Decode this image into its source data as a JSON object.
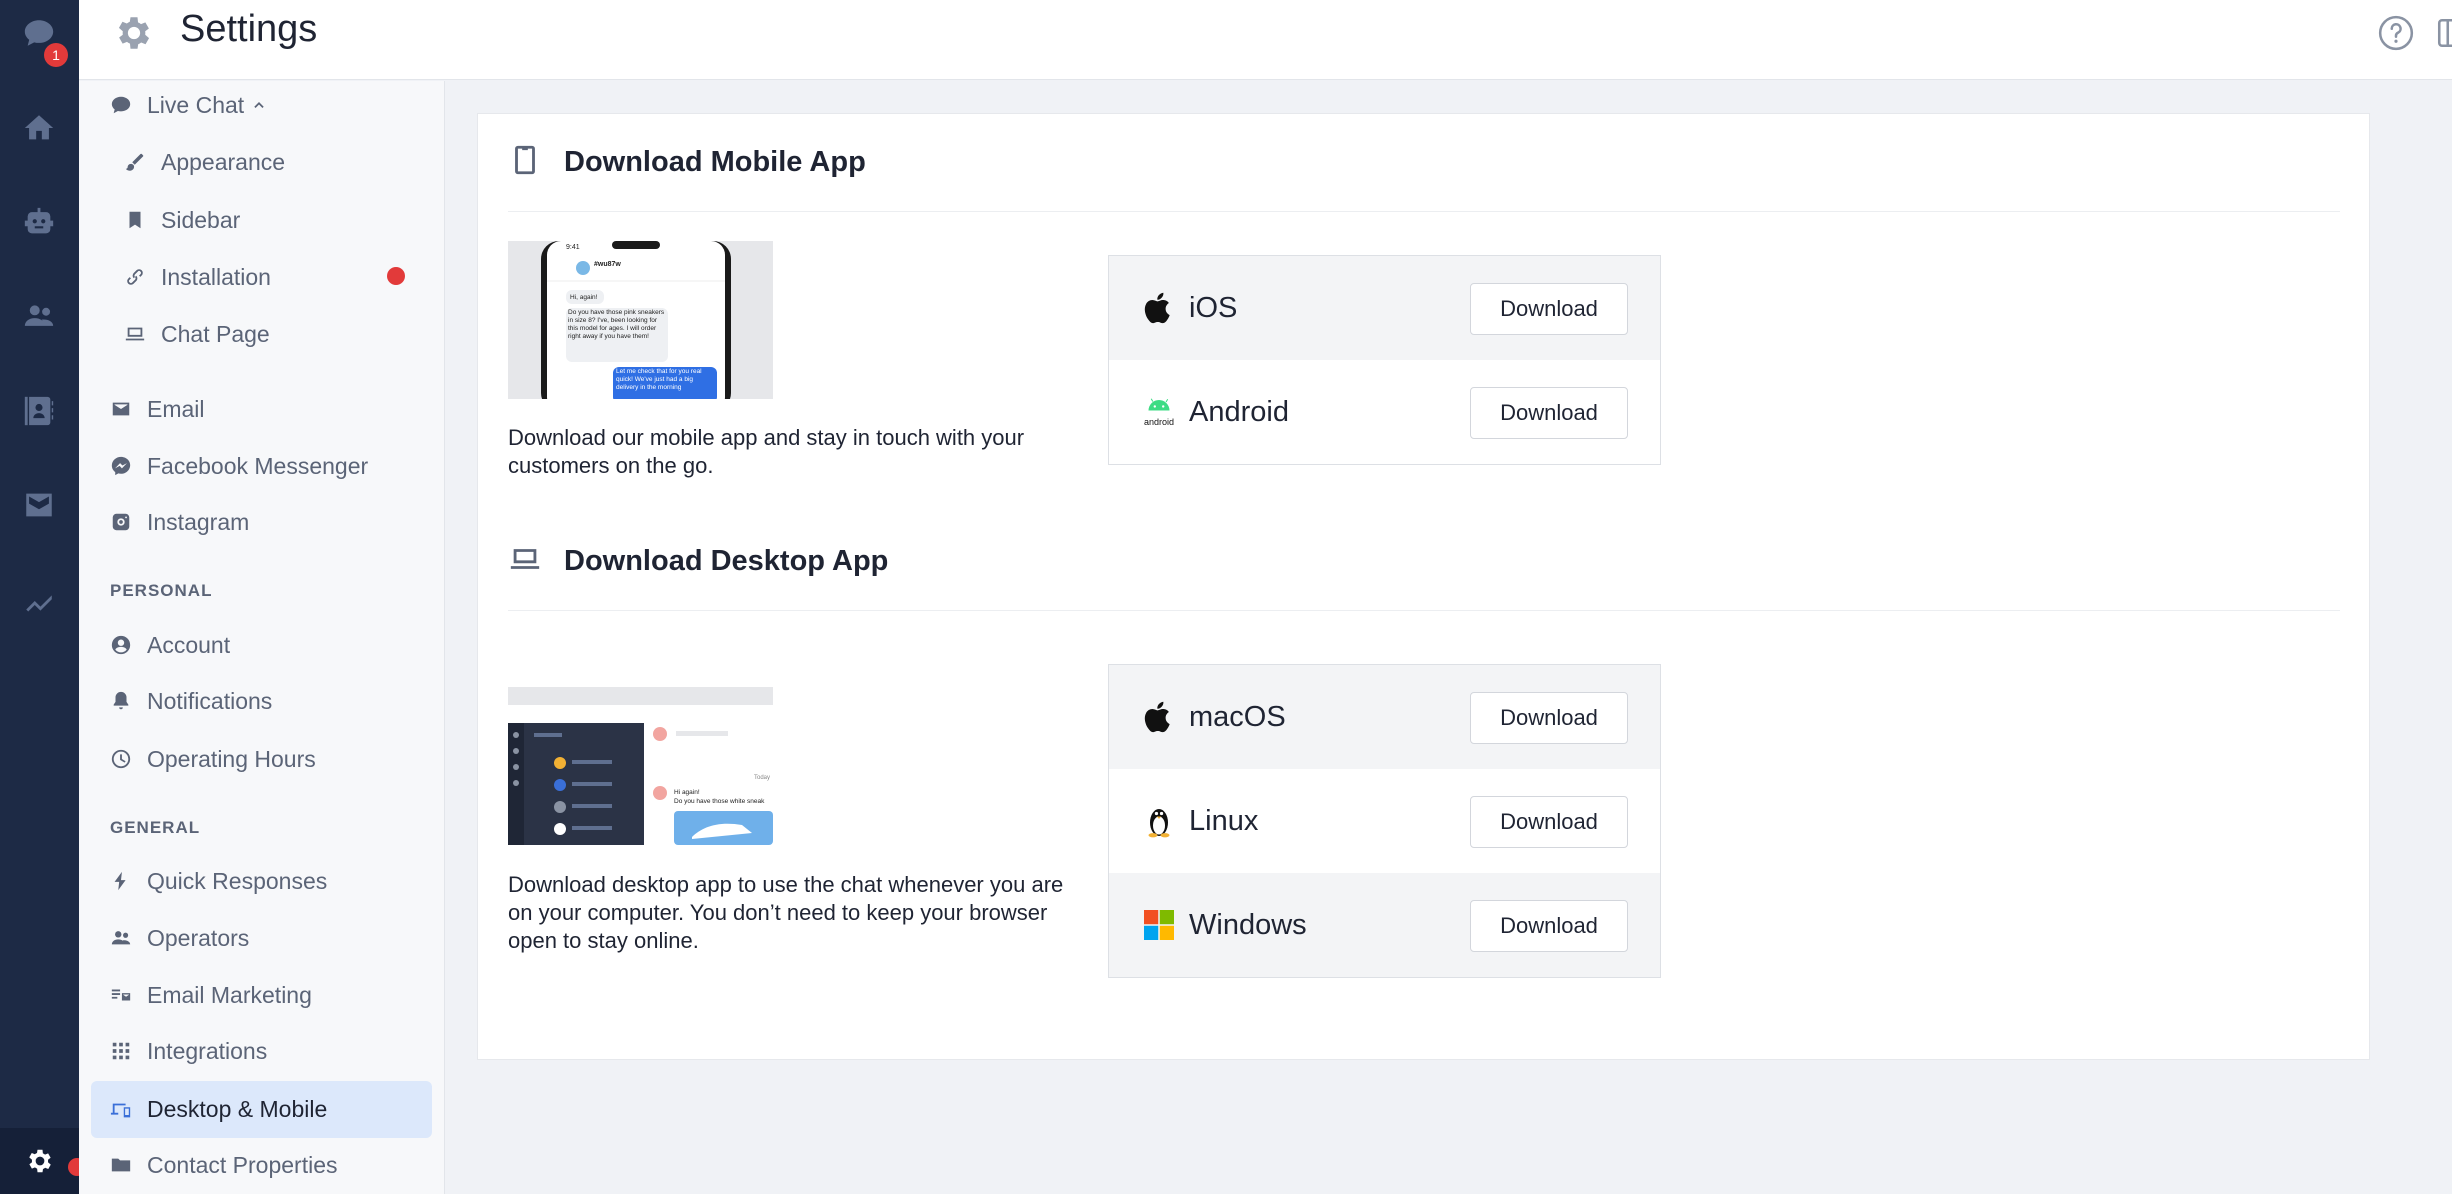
{
  "header": {
    "title": "Settings"
  },
  "rail": {
    "chat_badge": "1"
  },
  "sidebar": {
    "live_chat": "Live Chat",
    "sub_items": [
      "Appearance",
      "Sidebar",
      "Installation",
      "Chat Page"
    ],
    "channels": [
      "Email",
      "Facebook Messenger",
      "Instagram"
    ],
    "personal_caption": "PERSONAL",
    "personal": [
      "Account",
      "Notifications",
      "Operating Hours"
    ],
    "general_caption": "GENERAL",
    "general": [
      "Quick Responses",
      "Operators",
      "Email Marketing",
      "Integrations",
      "Desktop & Mobile",
      "Contact Properties"
    ]
  },
  "mobile": {
    "title": "Download Mobile App",
    "description": "Download our mobile app and stay in touch with your customers on the go.",
    "preview": {
      "time": "9:41",
      "name": "#wu87w",
      "b1": "Hi, again!",
      "b2": "Do you have those pink sneakers in size 8? I've, been looking for this model for ages. I will order right away if you have them!",
      "b3": "Let me check that for you real quick! We've just had a big delivery in the morning"
    },
    "platforms": [
      {
        "name": "iOS",
        "button": "Download"
      },
      {
        "name": "Android",
        "button": "Download",
        "icon_text": "android"
      }
    ]
  },
  "desktop": {
    "title": "Download Desktop App",
    "description": "Download desktop app to use the chat whenever you are on your computer. You don’t need to keep your browser open to stay online.",
    "preview": {
      "today": "Today",
      "m1": "Hi again!",
      "m2": "Do you have those white sneak"
    },
    "platforms": [
      {
        "name": "macOS",
        "button": "Download"
      },
      {
        "name": "Linux",
        "button": "Download"
      },
      {
        "name": "Windows",
        "button": "Download"
      }
    ]
  },
  "colors": {
    "rail": "#1d2a45",
    "accent": "#3a6fd8",
    "badge": "#e23a3a",
    "active_bg": "#dce8fb"
  }
}
